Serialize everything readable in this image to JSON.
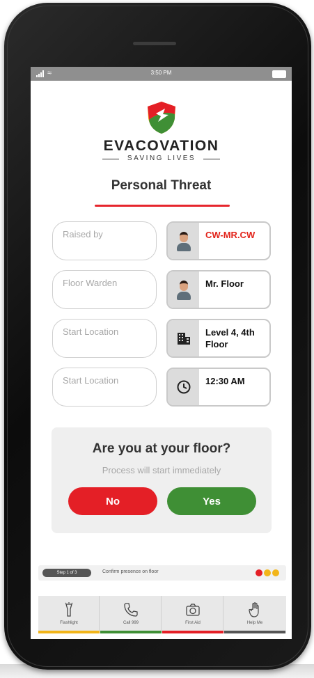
{
  "status_bar": {
    "time": "3:50 PM"
  },
  "brand": {
    "name": "EVACOVATION",
    "tagline": "SAVING LIVES"
  },
  "page": {
    "title": "Personal Threat"
  },
  "fields": [
    {
      "label": "Raised by",
      "value": "CW-MR.CW",
      "icon": "person-avatar-icon",
      "value_color": "#e2231a"
    },
    {
      "label": "Floor Warden",
      "value": "Mr. Floor",
      "icon": "person-avatar-icon"
    },
    {
      "label": "Start Location",
      "value": "Level 4, 4th Floor",
      "icon": "building-icon"
    },
    {
      "label": "Start Location",
      "value": "12:30 AM",
      "icon": "clock-icon"
    }
  ],
  "prompt": {
    "question": "Are you at your floor?",
    "subtitle": "Process will start immediately",
    "no_label": "No",
    "yes_label": "Yes"
  },
  "step": {
    "badge": "Step 1 of 3",
    "text": "Confirm presence on floor"
  },
  "nav": [
    {
      "label": "Flashlight",
      "icon": "flashlight-icon",
      "color": "#f2b51a"
    },
    {
      "label": "Call 999",
      "icon": "phone-icon",
      "color": "#3f8f35"
    },
    {
      "label": "First Aid",
      "icon": "camera-icon",
      "color": "#e41f26"
    },
    {
      "label": "Help Me",
      "icon": "hand-icon",
      "color": "#555555"
    }
  ],
  "colors": {
    "accent_red": "#e41f26",
    "accent_green": "#3f8f35",
    "accent_yellow": "#f2b51a"
  }
}
